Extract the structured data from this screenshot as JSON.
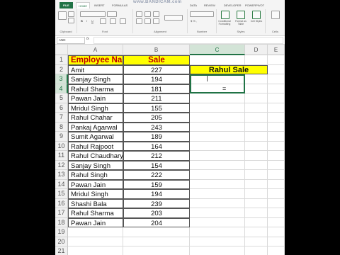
{
  "ribbon": {
    "tabs": [
      "FILE",
      "HOME",
      "INSERT",
      "FORMULAS",
      "DATA",
      "REVIEW",
      "DEVELOPER",
      "POWERPIVOT"
    ],
    "active_tab": "HOME",
    "watermark": "www.BANDICAM.com",
    "groups": [
      "Clipboard",
      "Font",
      "Alignment",
      "Number",
      "Styles",
      "Cells"
    ],
    "styles_items": [
      "Conditional Formatting",
      "Format as Table",
      "Cell Styles"
    ]
  },
  "formula_bar": {
    "name_box": "AND",
    "fx": "fx",
    "content": ""
  },
  "grid": {
    "columns": [
      "A",
      "B",
      "C",
      "D",
      "E"
    ],
    "selected_column": "C",
    "selected_rows": [
      3,
      4
    ],
    "row_numbers": [
      "1",
      "2",
      "3",
      "4",
      "5",
      "6",
      "7",
      "8",
      "9",
      "10",
      "11",
      "12",
      "13",
      "14",
      "15",
      "16",
      "17",
      "18",
      "19",
      "20",
      "21"
    ],
    "header": {
      "name": "Employee Name",
      "sale": "Sale"
    },
    "rows": [
      {
        "name": "Amit",
        "sale": "227"
      },
      {
        "name": "Sanjay Singh",
        "sale": "194"
      },
      {
        "name": "Rahul Sharma",
        "sale": "181"
      },
      {
        "name": "Pawan Jain",
        "sale": "211"
      },
      {
        "name": "Mridul Singh",
        "sale": "155"
      },
      {
        "name": "Rahul Chahar",
        "sale": "205"
      },
      {
        "name": "Pankaj Agarwal",
        "sale": "243"
      },
      {
        "name": "Sumit Agarwal",
        "sale": "189"
      },
      {
        "name": "Rahul Rajpoot",
        "sale": "164"
      },
      {
        "name": "Rahul Chaudhary",
        "sale": "212"
      },
      {
        "name": "Sanjay Singh",
        "sale": "154"
      },
      {
        "name": "Rahul Singh",
        "sale": "222"
      },
      {
        "name": "Pawan Jain",
        "sale": "159"
      },
      {
        "name": "Mridul Singh",
        "sale": "194"
      },
      {
        "name": "Shashi Bala",
        "sale": "239"
      },
      {
        "name": "Rahul Sharma",
        "sale": "203"
      },
      {
        "name": "Pawan Jain",
        "sale": "204"
      }
    ],
    "rahul_sale_label": "Rahul Sale",
    "editing_cell_text": "="
  },
  "colors": {
    "excel_green": "#217346",
    "header_fill": "#ffff00",
    "header_text": "#c00000"
  }
}
